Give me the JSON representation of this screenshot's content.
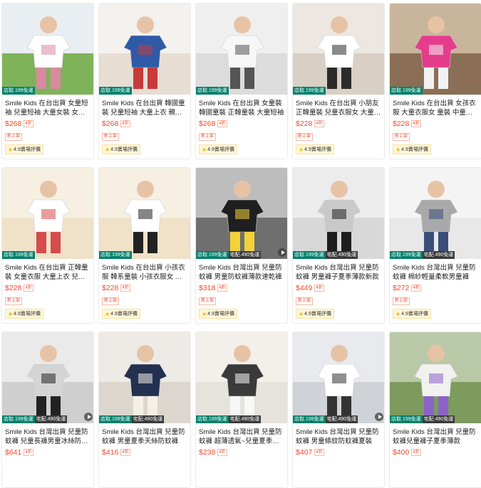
{
  "products": [
    {
      "title": "Smile Kids 在台出貨 女童短袖 兒童短袖 大童女裝 女童T恤",
      "price": "$268",
      "discount": "4折",
      "new_label": "新上架",
      "rating": "4.9",
      "rating_label": "賣場評價",
      "store_tag": "店取.199免運",
      "home_tag": "",
      "video": false,
      "colors": [
        "#7fb35a",
        "#e9eef2",
        "#ffffff",
        "#d98aa0"
      ]
    },
    {
      "title": "Smile Kids 在台出貨 韓國童裝 兒童短袖 大童上衣 親子裝",
      "price": "$268",
      "discount": "4折",
      "new_label": "新上架",
      "rating": "4.9",
      "rating_label": "賣場評價",
      "store_tag": "店取.199免運",
      "home_tag": "",
      "video": false,
      "colors": [
        "#e8ddd3",
        "#f4f1ee",
        "#2f5aa8",
        "#c73b3b"
      ]
    },
    {
      "title": "Smile Kids 在台出貨 女童裝 韓國童裝 正韓童裝 大童短袖",
      "price": "$268",
      "discount": "4折",
      "new_label": "新上架",
      "rating": "4.9",
      "rating_label": "賣場評價",
      "store_tag": "店取.199免運",
      "home_tag": "",
      "video": false,
      "colors": [
        "#dcdcdc",
        "#efefef",
        "#f7f7f7",
        "#555555"
      ]
    },
    {
      "title": "Smile Kids 在台出貨 小朋友 正韓童裝 兒童衣服女 大童女裝",
      "price": "$228",
      "discount": "4折",
      "new_label": "新上架",
      "rating": "4.9",
      "rating_label": "賣場評價",
      "store_tag": "店取.199免運",
      "home_tag": "",
      "video": false,
      "colors": [
        "#d9cfc4",
        "#ece7e1",
        "#ffffff",
        "#2b2b2b"
      ]
    },
    {
      "title": "Smile Kids 在台出貨 女孩衣服 大童衣服女 童裝 中童短袖",
      "price": "$228",
      "discount": "4折",
      "new_label": "新上架",
      "rating": "4.9",
      "rating_label": "賣場評價",
      "store_tag": "店取.199免運",
      "home_tag": "",
      "video": false,
      "colors": [
        "#8a6e55",
        "#c9b49c",
        "#e53c8c",
        "#f2f2f2"
      ]
    },
    {
      "title": "Smile Kids 在台出貨 正韓童裝 女童衣服 大童上衣 兒童短袖",
      "price": "$228",
      "discount": "4折",
      "new_label": "新上架",
      "rating": "4.9",
      "rating_label": "賣場評價",
      "store_tag": "店取.199免運",
      "home_tag": "",
      "video": false,
      "colors": [
        "#efe2c8",
        "#f6efe2",
        "#ffffff",
        "#d64b4b"
      ]
    },
    {
      "title": "Smile Kids 在台出貨 小孩衣服 韓系童裝 小孩衣服女 兒童短袖",
      "price": "$228",
      "discount": "4折",
      "new_label": "新上架",
      "rating": "4.9",
      "rating_label": "賣場評價",
      "store_tag": "店取.199免運",
      "home_tag": "",
      "video": false,
      "colors": [
        "#efe2c8",
        "#f6efe2",
        "#ffffff",
        "#222222"
      ]
    },
    {
      "title": "Smile Kids 台灣出貨 兒童防蚊褲 男童防蚊褲薄款速乾褲",
      "price": "$318",
      "discount": "4折",
      "new_label": "新上架",
      "rating": "4.9",
      "rating_label": "賣場評價",
      "store_tag": "店取.199免運",
      "home_tag": "宅配.490免運",
      "video": true,
      "colors": [
        "#6f6f6f",
        "#bdbdbd",
        "#1f1f1f",
        "#f2d23a"
      ]
    },
    {
      "title": "Smile Kids 台灣出貨 兒童防蚊褲 男童褲子夏季薄款新款",
      "price": "$449",
      "discount": "4折",
      "new_label": "新上架",
      "rating": "4.9",
      "rating_label": "賣場評價",
      "store_tag": "店取.199免運",
      "home_tag": "宅配.490免運",
      "video": false,
      "colors": [
        "#d8d8d8",
        "#ececec",
        "#c9c9c9",
        "#1d1d1d"
      ]
    },
    {
      "title": "Smile Kids 台灣出貨 兒童防蚊褲 棉紗輕量柔軟男童褲",
      "price": "$272",
      "discount": "4折",
      "new_label": "新上架",
      "rating": "4.9",
      "rating_label": "賣場評價",
      "store_tag": "店取.199免運",
      "home_tag": "宅配.490免運",
      "video": false,
      "colors": [
        "#e8e8e8",
        "#f4f4f4",
        "#a9a9a9",
        "#3b4e7a"
      ]
    },
    {
      "title": "Smile Kids 台灣出貨 兒童防蚊褲 兒童長褲男童冰絲防蚊褲",
      "price": "$641",
      "discount": "4折",
      "new_label": "",
      "rating": "",
      "rating_label": "",
      "store_tag": "店取.199免運",
      "home_tag": "宅配.490免運",
      "video": true,
      "colors": [
        "#cfcfcf",
        "#eaeaea",
        "#d4d4d4",
        "#222222"
      ]
    },
    {
      "title": "Smile Kids 台灣出貨 兒童防蚊褲 男童夏季天絲防蚊褲",
      "price": "$416",
      "discount": "4折",
      "new_label": "",
      "rating": "",
      "rating_label": "",
      "store_tag": "店取.199免運",
      "home_tag": "宅配.490免運",
      "video": false,
      "colors": [
        "#dcd6cf",
        "#eeeae5",
        "#23304f",
        "#f4f0e8"
      ]
    },
    {
      "title": "Smile Kids 台灣出貨 兒童防蚊褲 超薄透氣~兒童夏季防蚊褲",
      "price": "$238",
      "discount": "4折",
      "new_label": "",
      "rating": "",
      "rating_label": "",
      "store_tag": "店取.199免運",
      "home_tag": "宅配.490免運",
      "video": false,
      "colors": [
        "#e6e2dc",
        "#f3f0ec",
        "#3a3a3a",
        "#f7f7f7"
      ]
    },
    {
      "title": "Smile Kids 台灣出貨 兒童防蚊褲 男童條紋防蚊褲夏裝",
      "price": "$407",
      "discount": "4折",
      "new_label": "",
      "rating": "",
      "rating_label": "",
      "store_tag": "店取.199免運",
      "home_tag": "宅配.490免運",
      "video": true,
      "colors": [
        "#cfd2d6",
        "#e8eaed",
        "#ffffff",
        "#333333"
      ]
    },
    {
      "title": "Smile Kids 台灣出貨 兒童防蚊褲兒童褲子夏季薄款",
      "price": "$400",
      "discount": "4折",
      "new_label": "",
      "rating": "",
      "rating_label": "",
      "store_tag": "店取.199免運",
      "home_tag": "宅配.490免運",
      "video": false,
      "colors": [
        "#7c9b5c",
        "#b9c9a7",
        "#f1f1ef",
        "#8a63c9"
      ]
    }
  ]
}
